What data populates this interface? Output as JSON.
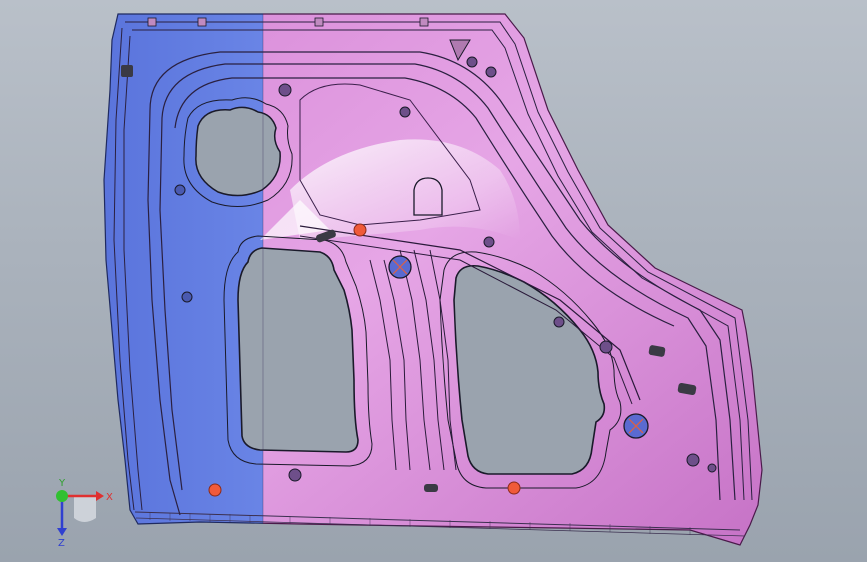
{
  "viewport": {
    "background_top": "#b9c0c9",
    "background_bottom": "#9aa3ae"
  },
  "model": {
    "name": "door-inner-panel",
    "left_section_color": "#6a86e6",
    "right_section_color": "#d07fd0",
    "hole_color": "#9aa3ae",
    "edge_color": "#2a2a3a",
    "marker_color": "#f05a3a"
  },
  "triad": {
    "x_label": "X",
    "y_label": "Y",
    "z_label": "Z",
    "x_color": "#e03030",
    "y_color": "#30c030",
    "z_color": "#3040d0"
  }
}
